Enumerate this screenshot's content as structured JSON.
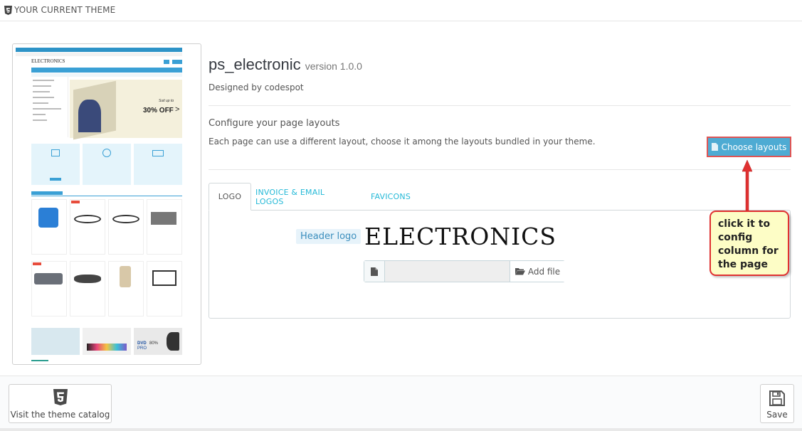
{
  "header": {
    "title": "YOUR CURRENT THEME",
    "icon": "html5-icon"
  },
  "theme": {
    "name": "ps_electronic",
    "version": "version 1.0.0",
    "designed_by": "Designed by codespot",
    "config_title": "Configure your page layouts",
    "config_desc": "Each page can use a different layout, choose it among the layouts bundled in your theme.",
    "choose_button": "Choose layouts"
  },
  "tabs": [
    {
      "label": "LOGO",
      "active": true
    },
    {
      "label": "INVOICE & EMAIL LOGOS",
      "active": false
    },
    {
      "label": "FAVICONS",
      "active": false
    }
  ],
  "logo_tab": {
    "label": "Header logo",
    "logo_text": "ELECTRONICS",
    "file_input_value": "",
    "add_file": "Add file"
  },
  "callout": {
    "text": "click it to config column for the page"
  },
  "preview": {
    "logo": "ELECTRONICS",
    "banner_line1": "Suit up to",
    "banner_line2": "30% OFF",
    "banner_arrow": ">",
    "card_ad": "DVD",
    "card_ad_sub": "PRO",
    "card_ad_pct": "80%"
  },
  "footer": {
    "catalog_button": "Visit the theme catalog",
    "save_button": "Save"
  },
  "colors": {
    "accent": "#25b9d7",
    "button_blue": "#4eabd3",
    "callout_border": "#e03131",
    "callout_bg": "#fdfdc6",
    "arrow": "#e03131"
  }
}
